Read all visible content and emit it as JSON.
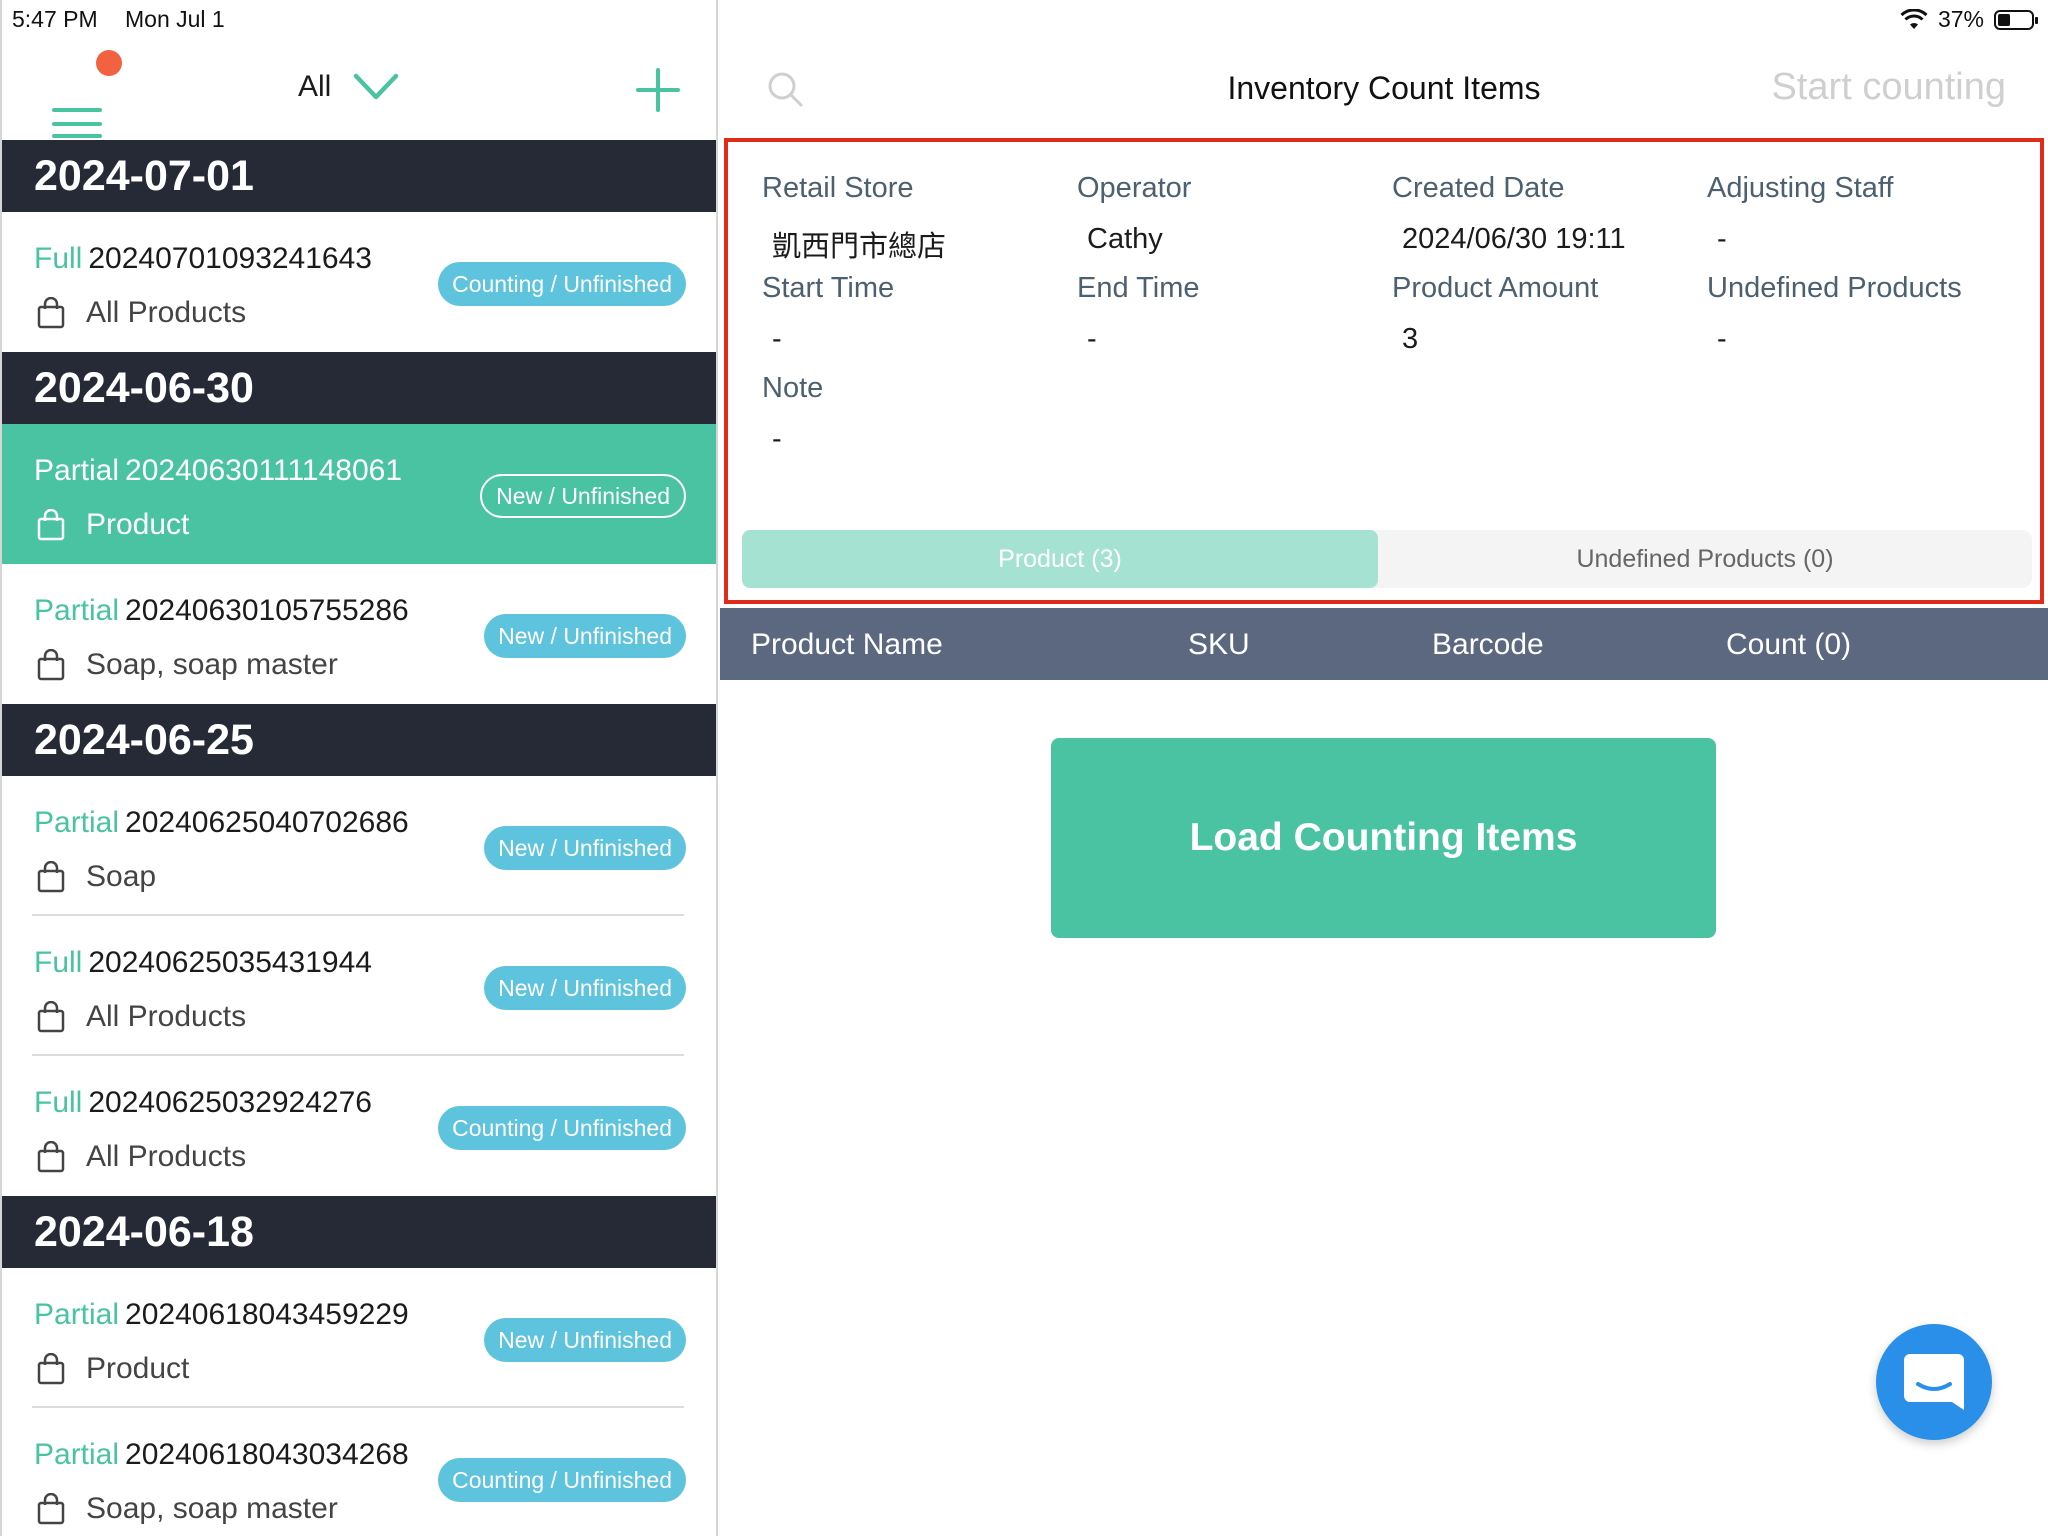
{
  "status_bar": {
    "time": "5:47 PM",
    "date": "Mon Jul 1",
    "battery": "37%"
  },
  "left_header": {
    "filter_label": "All"
  },
  "groups": [
    {
      "date": "2024-07-01",
      "items": [
        {
          "type": "Full",
          "code": "20240701093241643",
          "status": "Counting / Unfinished",
          "scope": "All Products"
        }
      ]
    },
    {
      "date": "2024-06-30",
      "items": [
        {
          "type": "Partial",
          "code": "20240630111148061",
          "status": "New / Unfinished",
          "scope": "Product"
        },
        {
          "type": "Partial",
          "code": "20240630105755286",
          "status": "New / Unfinished",
          "scope": "Soap, soap master"
        }
      ]
    },
    {
      "date": "2024-06-25",
      "items": [
        {
          "type": "Partial",
          "code": "20240625040702686",
          "status": "New / Unfinished",
          "scope": "Soap"
        },
        {
          "type": "Full",
          "code": "20240625035431944",
          "status": "New / Unfinished",
          "scope": "All Products"
        },
        {
          "type": "Full",
          "code": "20240625032924276",
          "status": "Counting / Unfinished",
          "scope": "All Products"
        }
      ]
    },
    {
      "date": "2024-06-18",
      "items": [
        {
          "type": "Partial",
          "code": "20240618043459229",
          "status": "New / Unfinished",
          "scope": "Product"
        },
        {
          "type": "Partial",
          "code": "20240618043034268",
          "status": "Counting / Unfinished",
          "scope": "Soap, soap master"
        }
      ]
    }
  ],
  "right_header": {
    "title": "Inventory Count Items",
    "start_counting": "Start counting"
  },
  "info": {
    "retail_store_label": "Retail Store",
    "retail_store": "凱西門市總店",
    "operator_label": "Operator",
    "operator": "Cathy",
    "created_date_label": "Created Date",
    "created_date": "2024/06/30 19:11",
    "adjusting_staff_label": "Adjusting Staff",
    "adjusting_staff": "-",
    "start_time_label": "Start Time",
    "start_time": "-",
    "end_time_label": "End Time",
    "end_time": "-",
    "product_amount_label": "Product Amount",
    "product_amount": "3",
    "undefined_products_label": "Undefined Products",
    "undefined_products": "-",
    "note_label": "Note",
    "note": "-"
  },
  "tabs": {
    "product": "Product (3)",
    "undefined": "Undefined Products (0)"
  },
  "table": {
    "product_name": "Product Name",
    "sku": "SKU",
    "barcode": "Barcode",
    "count": "Count (0)"
  },
  "load_button": "Load Counting Items",
  "colors": {
    "accent": "#4ac3a3",
    "badge": "#5ec3dc",
    "header_dark": "#252a36",
    "table_header": "#5c6780",
    "highlight_border": "#e02a1a",
    "notification": "#f26240",
    "chat": "#2a8fe8"
  },
  "icons": {
    "menu": "hamburger-icon",
    "add": "plus-icon",
    "search": "search-icon",
    "filter": "chevron-down-icon",
    "item": "shopping-bag-icon",
    "chat": "chat-icon"
  }
}
